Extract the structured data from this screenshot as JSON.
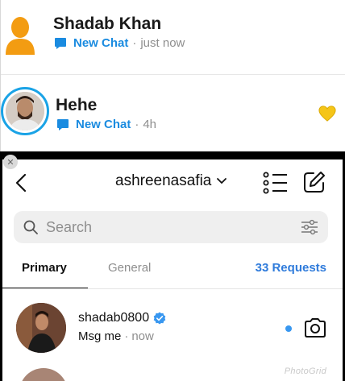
{
  "snap_chats": [
    {
      "name": "Shadab Khan",
      "status": "New Chat",
      "separator": "·",
      "time": "just now"
    },
    {
      "name": "Hehe",
      "status": "New Chat",
      "separator": "·",
      "time": "4h"
    }
  ],
  "colors": {
    "accent_blue": "#1a8be0",
    "ig_blue": "#3897f0",
    "heart_yellow": "#f5c518",
    "ghost_orange": "#f39c12"
  },
  "dm": {
    "username": "ashreenasafia",
    "search_placeholder": "Search",
    "tabs": {
      "primary": "Primary",
      "general": "General",
      "requests": "33 Requests"
    },
    "threads": [
      {
        "user": "shadab0800",
        "message": "Msg me",
        "separator": "·",
        "time": "now"
      }
    ]
  },
  "watermark": "PhotoGrid",
  "icons": [
    "close-icon",
    "chat-bubble-icon",
    "yellow-heart-icon",
    "back-arrow-icon",
    "chevron-down-icon",
    "list-icon",
    "compose-icon",
    "search-icon",
    "filter-icon",
    "verified-badge-icon",
    "camera-icon"
  ]
}
